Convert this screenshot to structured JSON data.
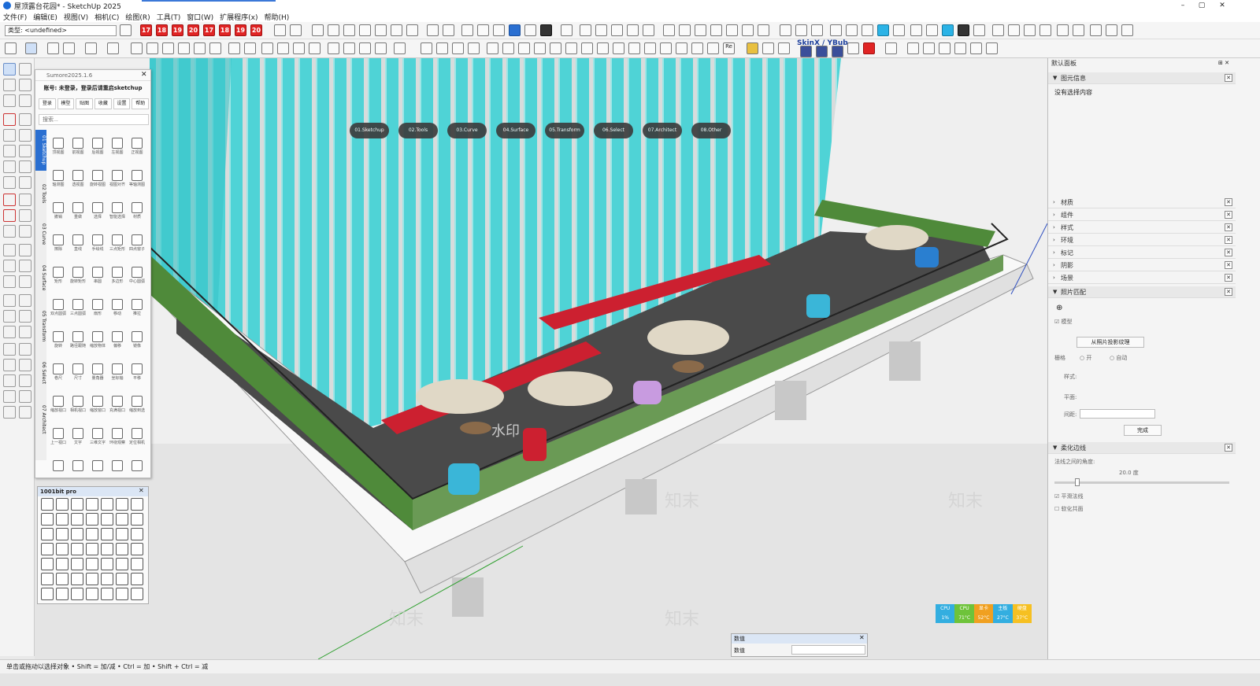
{
  "window": {
    "title": "屋顶露台花园* - SketchUp 2025",
    "controls": [
      "–",
      "▢",
      "✕"
    ]
  },
  "menu": [
    "文件(F)",
    "编辑(E)",
    "视图(V)",
    "相机(C)",
    "绘图(R)",
    "工具(T)",
    "窗口(W)",
    "扩展程序(x)",
    "帮助(H)"
  ],
  "toolbar": {
    "layer_label": "类型: <undefined>",
    "version_tags": [
      "17",
      "18",
      "19",
      "20",
      "17",
      "18",
      "19",
      "20"
    ],
    "skinx_label": "SkinX / YBub",
    "re_label": "Re"
  },
  "scene_tabs": [
    "01.Sketchup",
    "02.Tools",
    "03.Curve",
    "04.Surface",
    "05.Transform",
    "06.Select",
    "07.Architect",
    "08.Other"
  ],
  "sumore": {
    "title": "Sumore2025.1.6",
    "account": "账号: 未登录，登录后请重启sketchup",
    "tabs": [
      "登录",
      "模型",
      "贴图",
      "收藏",
      "设置",
      "帮助"
    ],
    "search_placeholder": "搜索...",
    "side_tabs": [
      "01 Sketchup",
      "02 Tools",
      "03 Curve",
      "04 Surface",
      "05 Transform",
      "06 Select",
      "07 Architect"
    ],
    "icons": [
      "顶视图",
      "前视图",
      "后视图",
      "左视图",
      "正视图",
      "轴测图",
      "透视图",
      "旋转视图",
      "视图对齐",
      "等轴测图",
      "撤销",
      "重做",
      "选择",
      "智能选择",
      "材质",
      "擦除",
      "直线",
      "手绘线",
      "三点矩形",
      "四点窗子",
      "矩形",
      "旋转矩形",
      "串圆",
      "多边形",
      "中心圆弧",
      "双点圆弧",
      "三点圆弧",
      "扇形",
      "移动",
      "推拉",
      "旋转",
      "路径跟随",
      "缩放物体",
      "偏移",
      "镜像",
      "卷尺",
      "尺寸",
      "量角器",
      "坐标轴",
      "平移",
      "缩放视口",
      "相机视口",
      "缩放窗口",
      "充满视口",
      "缩放到选",
      "上一视口",
      "文字",
      "三维文字",
      "环绕观察",
      "定位相机"
    ]
  },
  "pro1001": {
    "title": "1001bit pro"
  },
  "right_panel": {
    "title": "默认面板",
    "entity_info": "图元信息",
    "no_selection": "没有选择内容",
    "sections": [
      "材质",
      "组件",
      "样式",
      "环境",
      "标记",
      "阴影",
      "场景",
      "照片匹配"
    ],
    "photo_match": {
      "model_label": "模型",
      "from_photo": "从照片投影纹理",
      "grid_label": "栅格",
      "on": "开",
      "auto": "自动",
      "style": "样式:",
      "plane": "平面:",
      "spacing": "间距:",
      "done": "完成"
    },
    "soften": {
      "title": "柔化边线",
      "angle_label": "法线之间的角度:",
      "angle_value": "20.0 度",
      "smooth": "平滑法线",
      "coplanar": "软化共面"
    }
  },
  "sysmon": [
    {
      "k": "CPU",
      "v": "1%",
      "c": "#33aee0"
    },
    {
      "k": "CPU",
      "v": "71°C",
      "c": "#6ec33a"
    },
    {
      "k": "显卡",
      "v": "52°C",
      "c": "#f0a020"
    },
    {
      "k": "主板",
      "v": "27°C",
      "c": "#33aee0"
    },
    {
      "k": "硬盘",
      "v": "37°C",
      "c": "#f6c022"
    }
  ],
  "value_box": {
    "title": "数值",
    "label": "数值"
  },
  "watermark": "水印",
  "watermark_brand": "知末",
  "status": "单击或拖动以选择对象 • Shift = 加/减 • Ctrl = 加 • Shift + Ctrl = 减"
}
